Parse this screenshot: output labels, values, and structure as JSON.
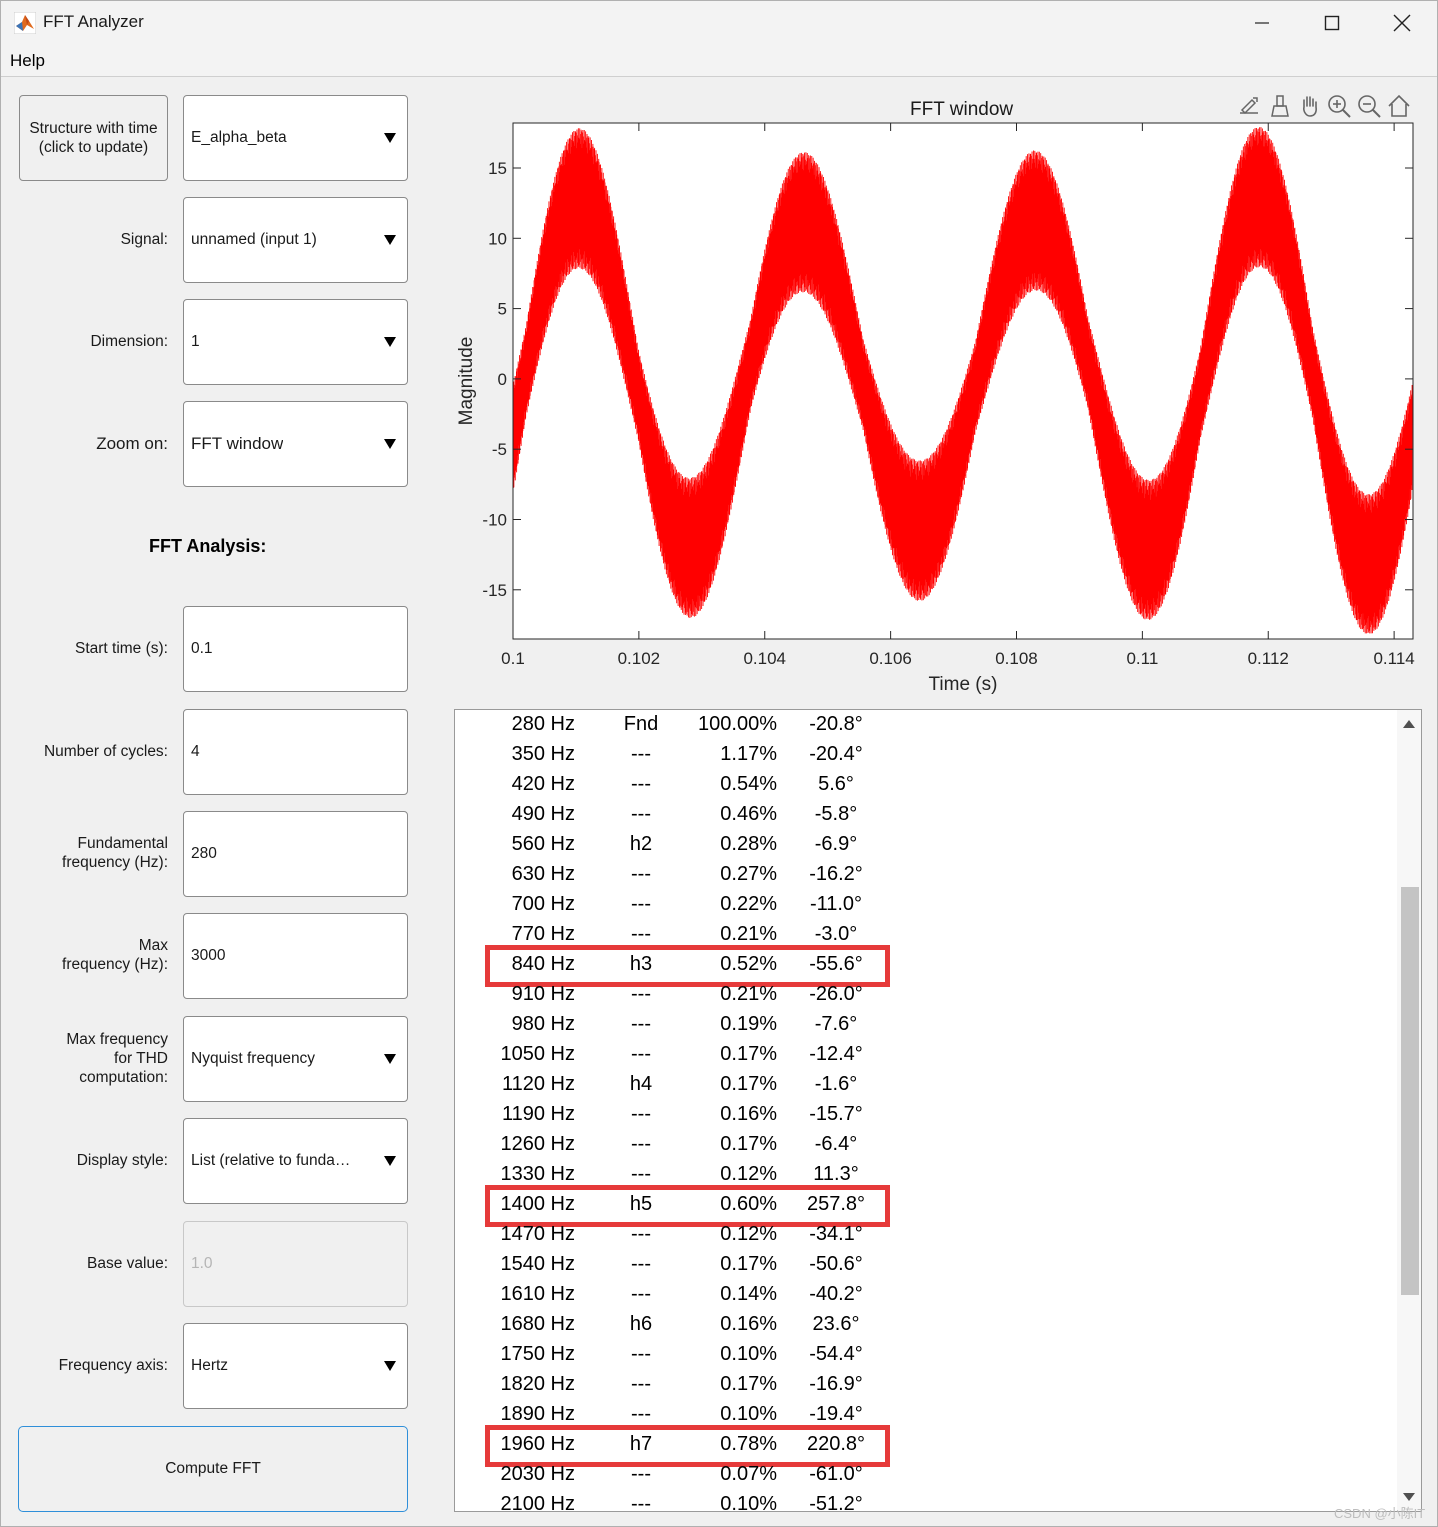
{
  "window": {
    "title": "FFT Analyzer",
    "menu": [
      "Help"
    ]
  },
  "controls": {
    "structure_button": "Structure with time\n(click to update)",
    "structure_value": "E_alpha_beta",
    "signal_label": "Signal:",
    "signal_value": "unnamed (input 1)",
    "dimension_label": "Dimension:",
    "dimension_value": "1",
    "zoom_label": "Zoom on:",
    "zoom_value": "FFT window",
    "fft_analysis_title": "FFT Analysis:",
    "start_time_label": "Start time (s):",
    "start_time_value": "0.1",
    "cycles_label": "Number of cycles:",
    "cycles_value": "4",
    "fund_freq_label": "Fundamental\nfrequency (Hz):",
    "fund_freq_value": "280",
    "max_freq_label": "Max\nfrequency (Hz):",
    "max_freq_value": "3000",
    "thd_label": "Max frequency\nfor THD\ncomputation:",
    "thd_value": "Nyquist frequency",
    "display_style_label": "Display style:",
    "display_style_value": "List (relative to funda…",
    "base_value_label": "Base value:",
    "base_value_value": "1.0",
    "freq_axis_label": "Frequency axis:",
    "freq_axis_value": "Hertz",
    "compute_button": "Compute FFT"
  },
  "chart_data": {
    "type": "line",
    "title": "FFT window",
    "xlabel": "Time (s)",
    "ylabel": "Magnitude",
    "xlim": [
      0.1,
      0.1143
    ],
    "ylim": [
      -18.5,
      18.2
    ],
    "x_ticks": [
      0.1,
      0.102,
      0.104,
      0.106,
      0.108,
      0.11,
      0.112,
      0.114
    ],
    "x_tick_labels": [
      "0.1",
      "0.102",
      "0.104",
      "0.106",
      "0.108",
      "0.11",
      "0.112",
      "0.114"
    ],
    "y_ticks": [
      15,
      10,
      5,
      0,
      -5,
      -10,
      -15
    ],
    "y_tick_labels": [
      "15",
      "10",
      "5",
      "0",
      "-5",
      "-10",
      "-15"
    ],
    "line_color": "#ff0000",
    "series": [
      {
        "fundamental_hz": 280,
        "fundamental_amplitude": 12,
        "ripple_amplitude": 5,
        "phase_deg": -20.8,
        "t_start": 0.1,
        "cycles": 4
      }
    ]
  },
  "results": {
    "rows": [
      [
        "280 Hz",
        "Fnd",
        "100.00%",
        "-20.8°"
      ],
      [
        "350 Hz",
        "---",
        "1.17%",
        "-20.4°"
      ],
      [
        "420 Hz",
        "---",
        "0.54%",
        "5.6°"
      ],
      [
        "490 Hz",
        "---",
        "0.46%",
        "-5.8°"
      ],
      [
        "560 Hz",
        "h2",
        "0.28%",
        "-6.9°"
      ],
      [
        "630 Hz",
        "---",
        "0.27%",
        "-16.2°"
      ],
      [
        "700 Hz",
        "---",
        "0.22%",
        "-11.0°"
      ],
      [
        "770 Hz",
        "---",
        "0.21%",
        "-3.0°"
      ],
      [
        "840 Hz",
        "h3",
        "0.52%",
        "-55.6°"
      ],
      [
        "910 Hz",
        "---",
        "0.21%",
        "-26.0°"
      ],
      [
        "980 Hz",
        "---",
        "0.19%",
        "-7.6°"
      ],
      [
        "1050 Hz",
        "---",
        "0.17%",
        "-12.4°"
      ],
      [
        "1120 Hz",
        "h4",
        "0.17%",
        "-1.6°"
      ],
      [
        "1190 Hz",
        "---",
        "0.16%",
        "-15.7°"
      ],
      [
        "1260 Hz",
        "---",
        "0.17%",
        "-6.4°"
      ],
      [
        "1330 Hz",
        "---",
        "0.12%",
        "11.3°"
      ],
      [
        "1400 Hz",
        "h5",
        "0.60%",
        "257.8°"
      ],
      [
        "1470 Hz",
        "---",
        "0.12%",
        "-34.1°"
      ],
      [
        "1540 Hz",
        "---",
        "0.17%",
        "-50.6°"
      ],
      [
        "1610 Hz",
        "---",
        "0.14%",
        "-40.2°"
      ],
      [
        "1680 Hz",
        "h6",
        "0.16%",
        "23.6°"
      ],
      [
        "1750 Hz",
        "---",
        "0.10%",
        "-54.4°"
      ],
      [
        "1820 Hz",
        "---",
        "0.17%",
        "-16.9°"
      ],
      [
        "1890 Hz",
        "---",
        "0.10%",
        "-19.4°"
      ],
      [
        "1960 Hz",
        "h7",
        "0.78%",
        "220.8°"
      ],
      [
        "2030 Hz",
        "---",
        "0.07%",
        "-61.0°"
      ],
      [
        "2100 Hz",
        "---",
        "0.10%",
        "-51.2°"
      ]
    ],
    "highlighted": [
      "840 Hz",
      "1400 Hz",
      "1960 Hz"
    ],
    "highlight_color": "#e63a3a"
  },
  "watermark": "CSDN @小陈IT"
}
